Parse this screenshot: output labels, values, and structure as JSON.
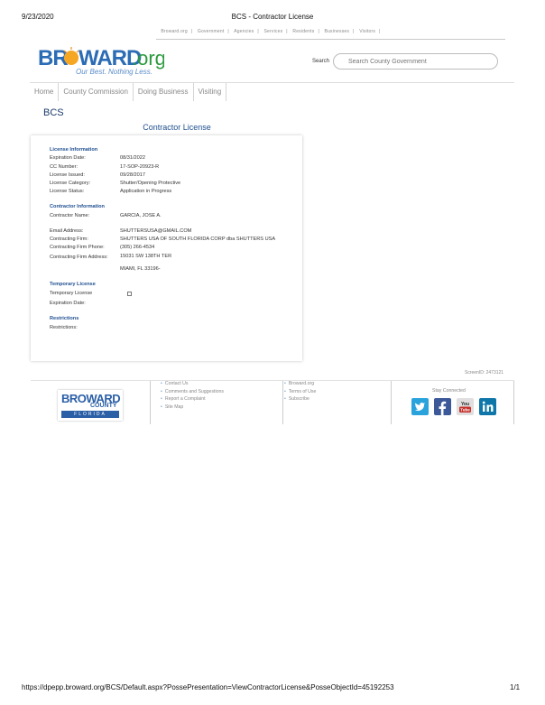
{
  "print_header": {
    "date": "9/23/2020",
    "title": "BCS - Contractor License"
  },
  "top_nav": [
    "Broward.org",
    "Government",
    "Agencies",
    "Services",
    "Residents",
    "Businesses",
    "Visitors"
  ],
  "logo": {
    "brand": "BROWARD.org",
    "tagline": "Our Best. Nothing Less."
  },
  "search": {
    "label": "Search",
    "placeholder": "Search County Government"
  },
  "main_nav": [
    "Home",
    "County Commission",
    "Doing Business",
    "Visiting"
  ],
  "section_label": "BCS",
  "page_heading": "Contractor License",
  "license_info": {
    "title": "License Information",
    "rows": [
      {
        "label": "Expiration Date:",
        "value": "08/31/2022"
      },
      {
        "label": "CC Number:",
        "value": "17-SOP-20923-R"
      },
      {
        "label": "License Issued:",
        "value": "09/28/2017"
      },
      {
        "label": "License Category:",
        "value": "Shutter/Opening Protective"
      },
      {
        "label": "License Status:",
        "value": "Application in Progress"
      }
    ]
  },
  "contractor_info": {
    "title": "Contractor Information",
    "name_label": "Contractor Name:",
    "name_value": "GARCIA, JOSE A.",
    "email_label": "Email Address:",
    "email_value": "SHUTTERSUSA@GMAIL.COM",
    "firm_label": "Contracting Firm:",
    "firm_value": "SHUTTERS USA OF SOUTH FLORIDA CORP dba SHUTTERS USA",
    "phone_label": "Contracting Firm Phone:",
    "phone_value": "(305) 266-4534",
    "address_label": "Contracting Firm Address:",
    "address_line1": "15031 SW 138TH TER",
    "address_line2": "MIAMI, FL 33196-"
  },
  "temporary_license": {
    "title": "Temporary License",
    "temp_label": "Temporary License",
    "temp_checked": false,
    "exp_label": "Expiration Date:"
  },
  "restrictions": {
    "title": "Restrictions",
    "label": "Restrictions:"
  },
  "screen_id": "ScreenID: 2473121",
  "footer": {
    "logo_brand": "BROWARD",
    "logo_sub": "COUNTY",
    "logo_state": "FLORIDA",
    "col1": [
      "Contact Us",
      "Comments and Suggestions",
      "Report a Complaint",
      "Site Map"
    ],
    "col2": [
      "Broward.org",
      "Terms of Use",
      "Subscribe"
    ],
    "stay_connected": "Stay Connected",
    "social": [
      "twitter-icon",
      "facebook-icon",
      "youtube-icon",
      "linkedin-icon"
    ],
    "colors": {
      "twitter": "#2aa3dc",
      "facebook": "#3b5998",
      "youtube": "#c4302b",
      "linkedin": "#0e76a8"
    }
  },
  "print_footer": {
    "url": "https://dpepp.broward.org/BCS/Default.aspx?PossePresentation=ViewContractorLicense&PosseObjectId=45192253",
    "page": "1/1"
  }
}
